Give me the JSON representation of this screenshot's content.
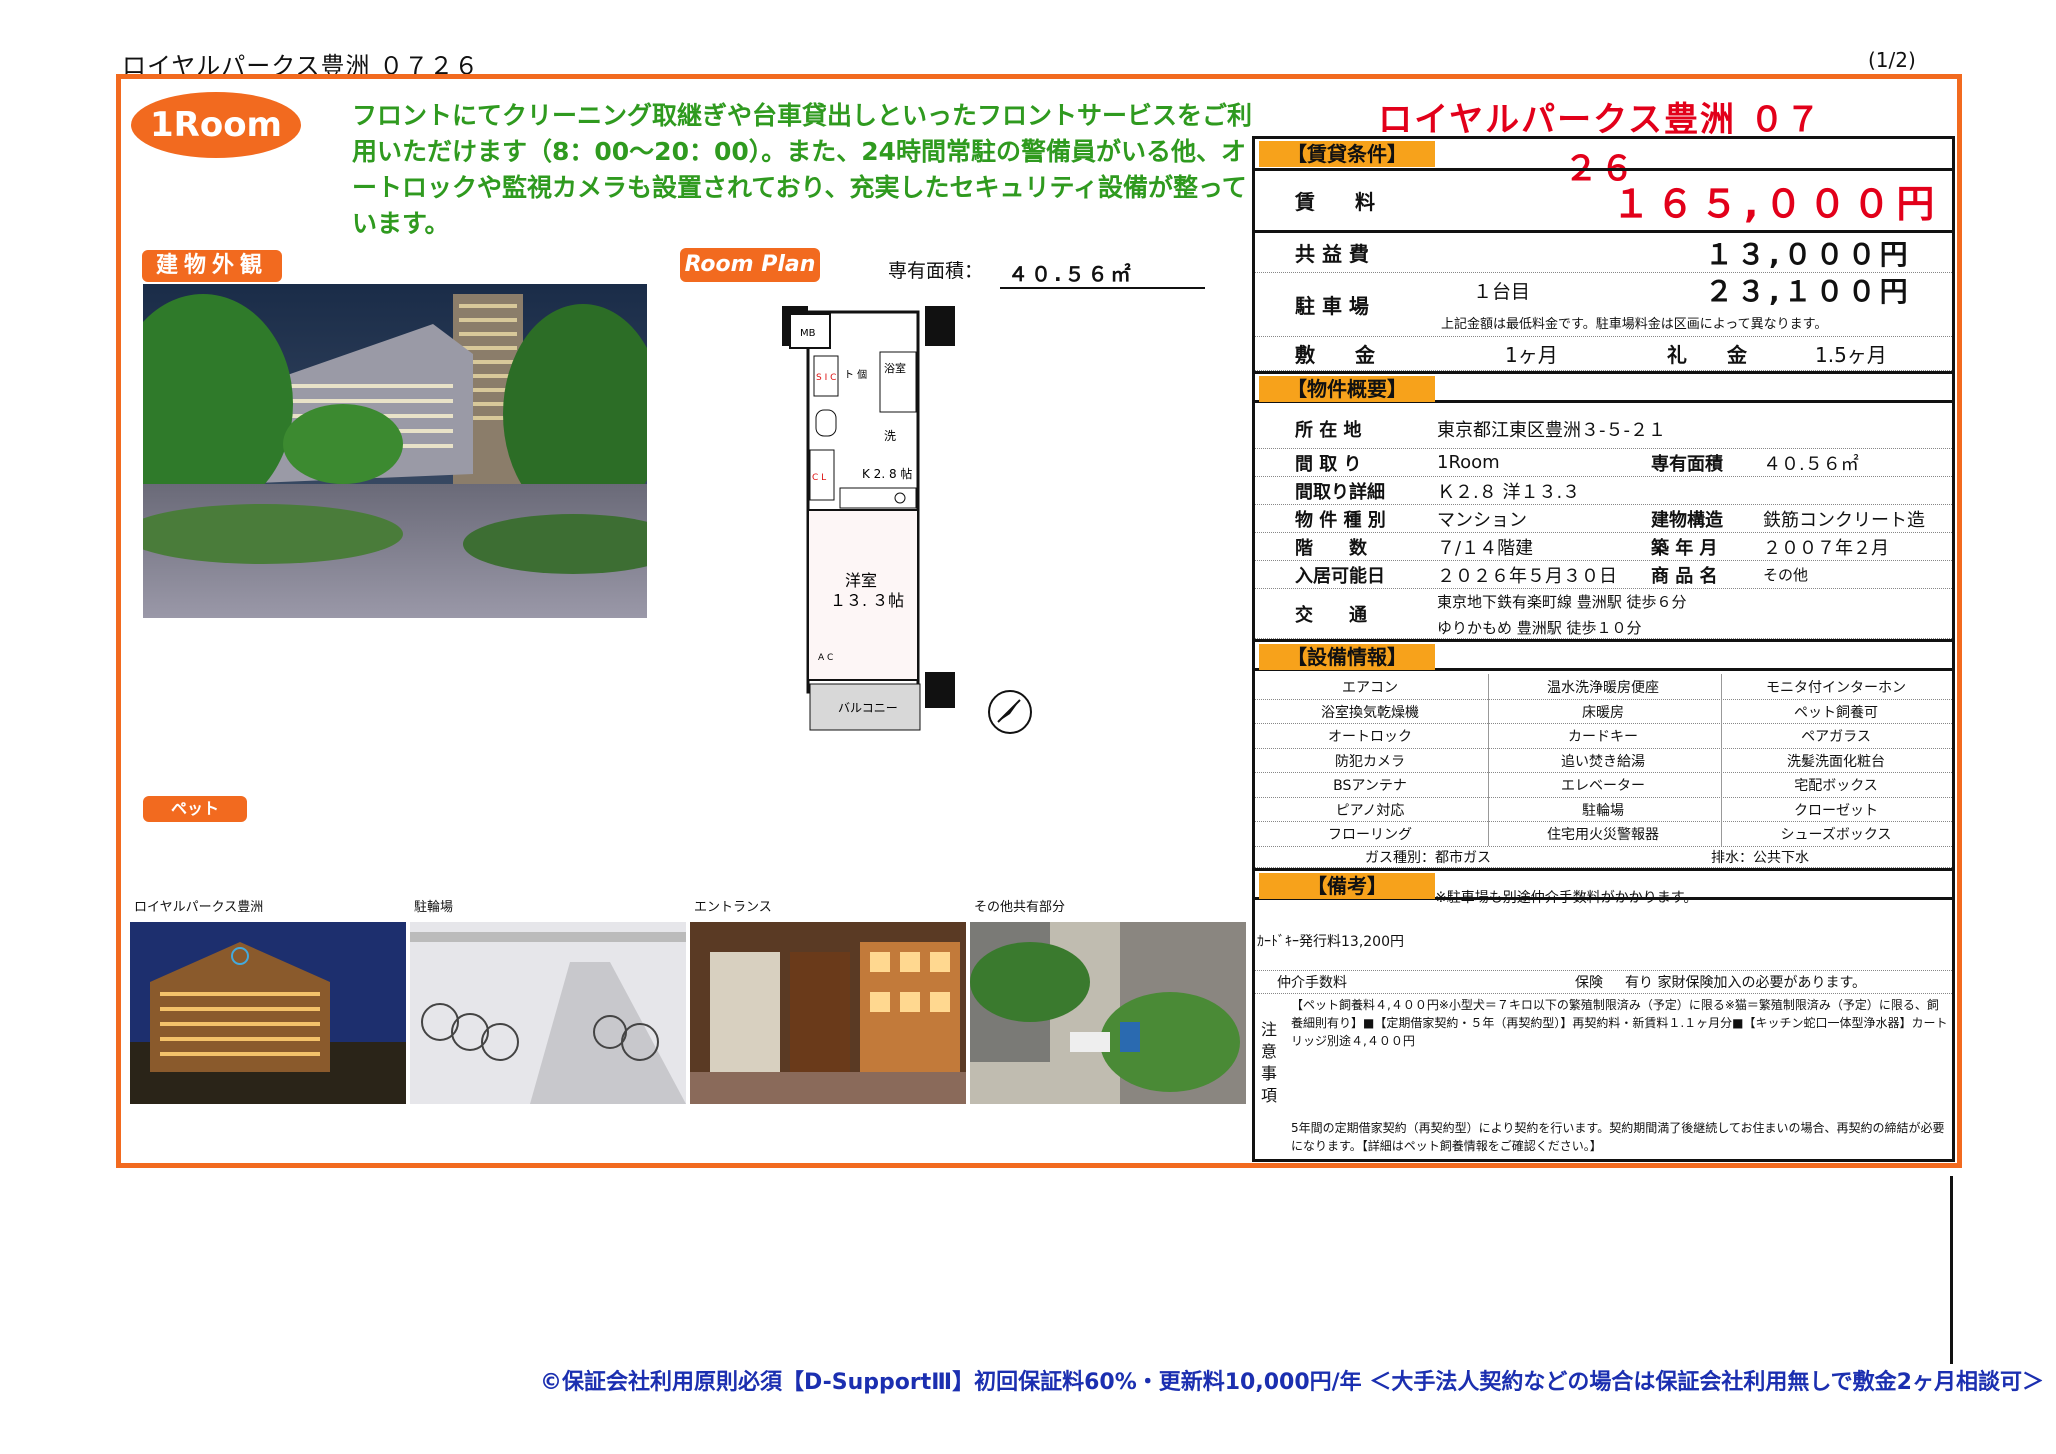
{
  "header": {
    "title": "ロイヤルパークス豊洲 ０７２６",
    "page": "(1/2)"
  },
  "badge": "1Room",
  "intro": "フロントにてクリーニング取継ぎや台車貸出しといったフロントサービスをご利用いただけます（8：00〜20：00）。また、24時間常駐の警備員がいる他、オートロックや監視カメラも設置されており、充実したセキュリティ設備が整っています。",
  "left": {
    "exterior_label": "建物外観",
    "plan_label": "Room Plan",
    "area_label": "専有面積：",
    "area_value": "４０.５６㎡",
    "pet_label": "ペット",
    "plan": {
      "mb": "MB",
      "sc": "S I C",
      "bath": "浴室",
      "toilet": "ト 個",
      "wash": "洗",
      "k": "K 2. 8 帖",
      "cl": "C L",
      "room": "洋室",
      "room_size": "１３. ３帖",
      "ac": "A C",
      "balcony": "バルコニー"
    }
  },
  "gallery": [
    {
      "caption": "ロイヤルパークス豊洲"
    },
    {
      "caption": "駐輪場"
    },
    {
      "caption": "エントランス"
    },
    {
      "caption": "その他共有部分"
    }
  ],
  "right": {
    "title": "ロイヤルパークス豊洲 ０７２６",
    "sec_rent": "【賃貸条件】",
    "rent_label": "賃　　料",
    "rent_value": "１６５,０００円",
    "common_label": "共 益 費",
    "common_value": "１３,０００円",
    "parking_label": "駐 車 場",
    "parking_slot": "１台目",
    "parking_value": "２３,１００円",
    "parking_note": "上記金額は最低料金です。駐車場料金は区画によって異なります。",
    "deposit_label": "敷　　金",
    "deposit_value": "1ヶ月",
    "key_label": "礼　　金",
    "key_value": "1.5ヶ月",
    "sec_prop": "【物件概要】",
    "addr_label": "所 在 地",
    "addr_value": "東京都江東区豊洲３-５-２１",
    "layout_label": "間 取 り",
    "layout_value": "1Room",
    "area_label": "専有面積",
    "area_value": "４０.５６㎡",
    "detail_label": "間取り詳細",
    "detail_value": "Ｋ２.８ 洋１３.３",
    "type_label": "物 件 種 別",
    "type_value": "マンション",
    "struct_label": "建物構造",
    "struct_value": "鉄筋コンクリート造",
    "floor_label": "階　　数",
    "floor_value": "７/１４階建",
    "built_label": "築 年 月",
    "built_value": "２００７年２月",
    "move_label": "入居可能日",
    "move_value": "２０２６年５月３０日",
    "biz_label": "商 品 名",
    "biz_value": "その他",
    "transit_label": "交　　通",
    "transit_1": "東京地下鉄有楽町線 豊洲駅 徒歩６分",
    "transit_2": "ゆりかもめ 豊洲駅 徒歩１０分",
    "sec_equip": "【設備情報】",
    "equipment": [
      "エアコン",
      "温水洗浄暖房便座",
      "モニタ付インターホン",
      "浴室換気乾燥機",
      "床暖房",
      "ペット飼養可",
      "オートロック",
      "カードキー",
      "ペアガラス",
      "防犯カメラ",
      "追い焚き給湯",
      "洗髪洗面化粧台",
      "BSアンテナ",
      "エレベーター",
      "宅配ボックス",
      "ピアノ対応",
      "駐輪場",
      "クローゼット",
      "フローリング",
      "住宅用火災警報器",
      "シューズボックス"
    ],
    "gas": "ガス種別：都市ガス",
    "drain": "排水：公共下水",
    "sec_notes": "【備考】",
    "notes_head": "※駐車場も別途仲介手数料がかかります。",
    "card_fee": "ｶｰﾄﾞｷｰ発行料13,200円",
    "broker_label": "仲介手数料",
    "insurance_label": "保険",
    "insurance_value": "有り 家財保険加入の必要があります。",
    "caution_label": "注意事項",
    "caution_1": "【ペット飼養料４,４００円※小型犬＝７キロ以下の繁殖制限済み（予定）に限る※猫＝繁殖制限済み（予定）に限る、飼養細則有り】■【定期借家契約・５年（再契約型）】再契約料・新賃料１.１ヶ月分■【キッチン蛇口一体型浄水器】カートリッジ別途４,４００円",
    "caution_2": "5年間の定期借家契約（再契約型）により契約を行います。契約期間満了後継続してお住まいの場合、再契約の締結が必要になります。【詳細はペット飼養情報をご確認ください。】"
  },
  "footer": "©保証会社利用原則必須【D-SupportⅢ】初回保証料60%・更新料10,000円/年 ＜大手法人契約などの場合は保証会社利用無しで敷金2ヶ月相談可＞"
}
